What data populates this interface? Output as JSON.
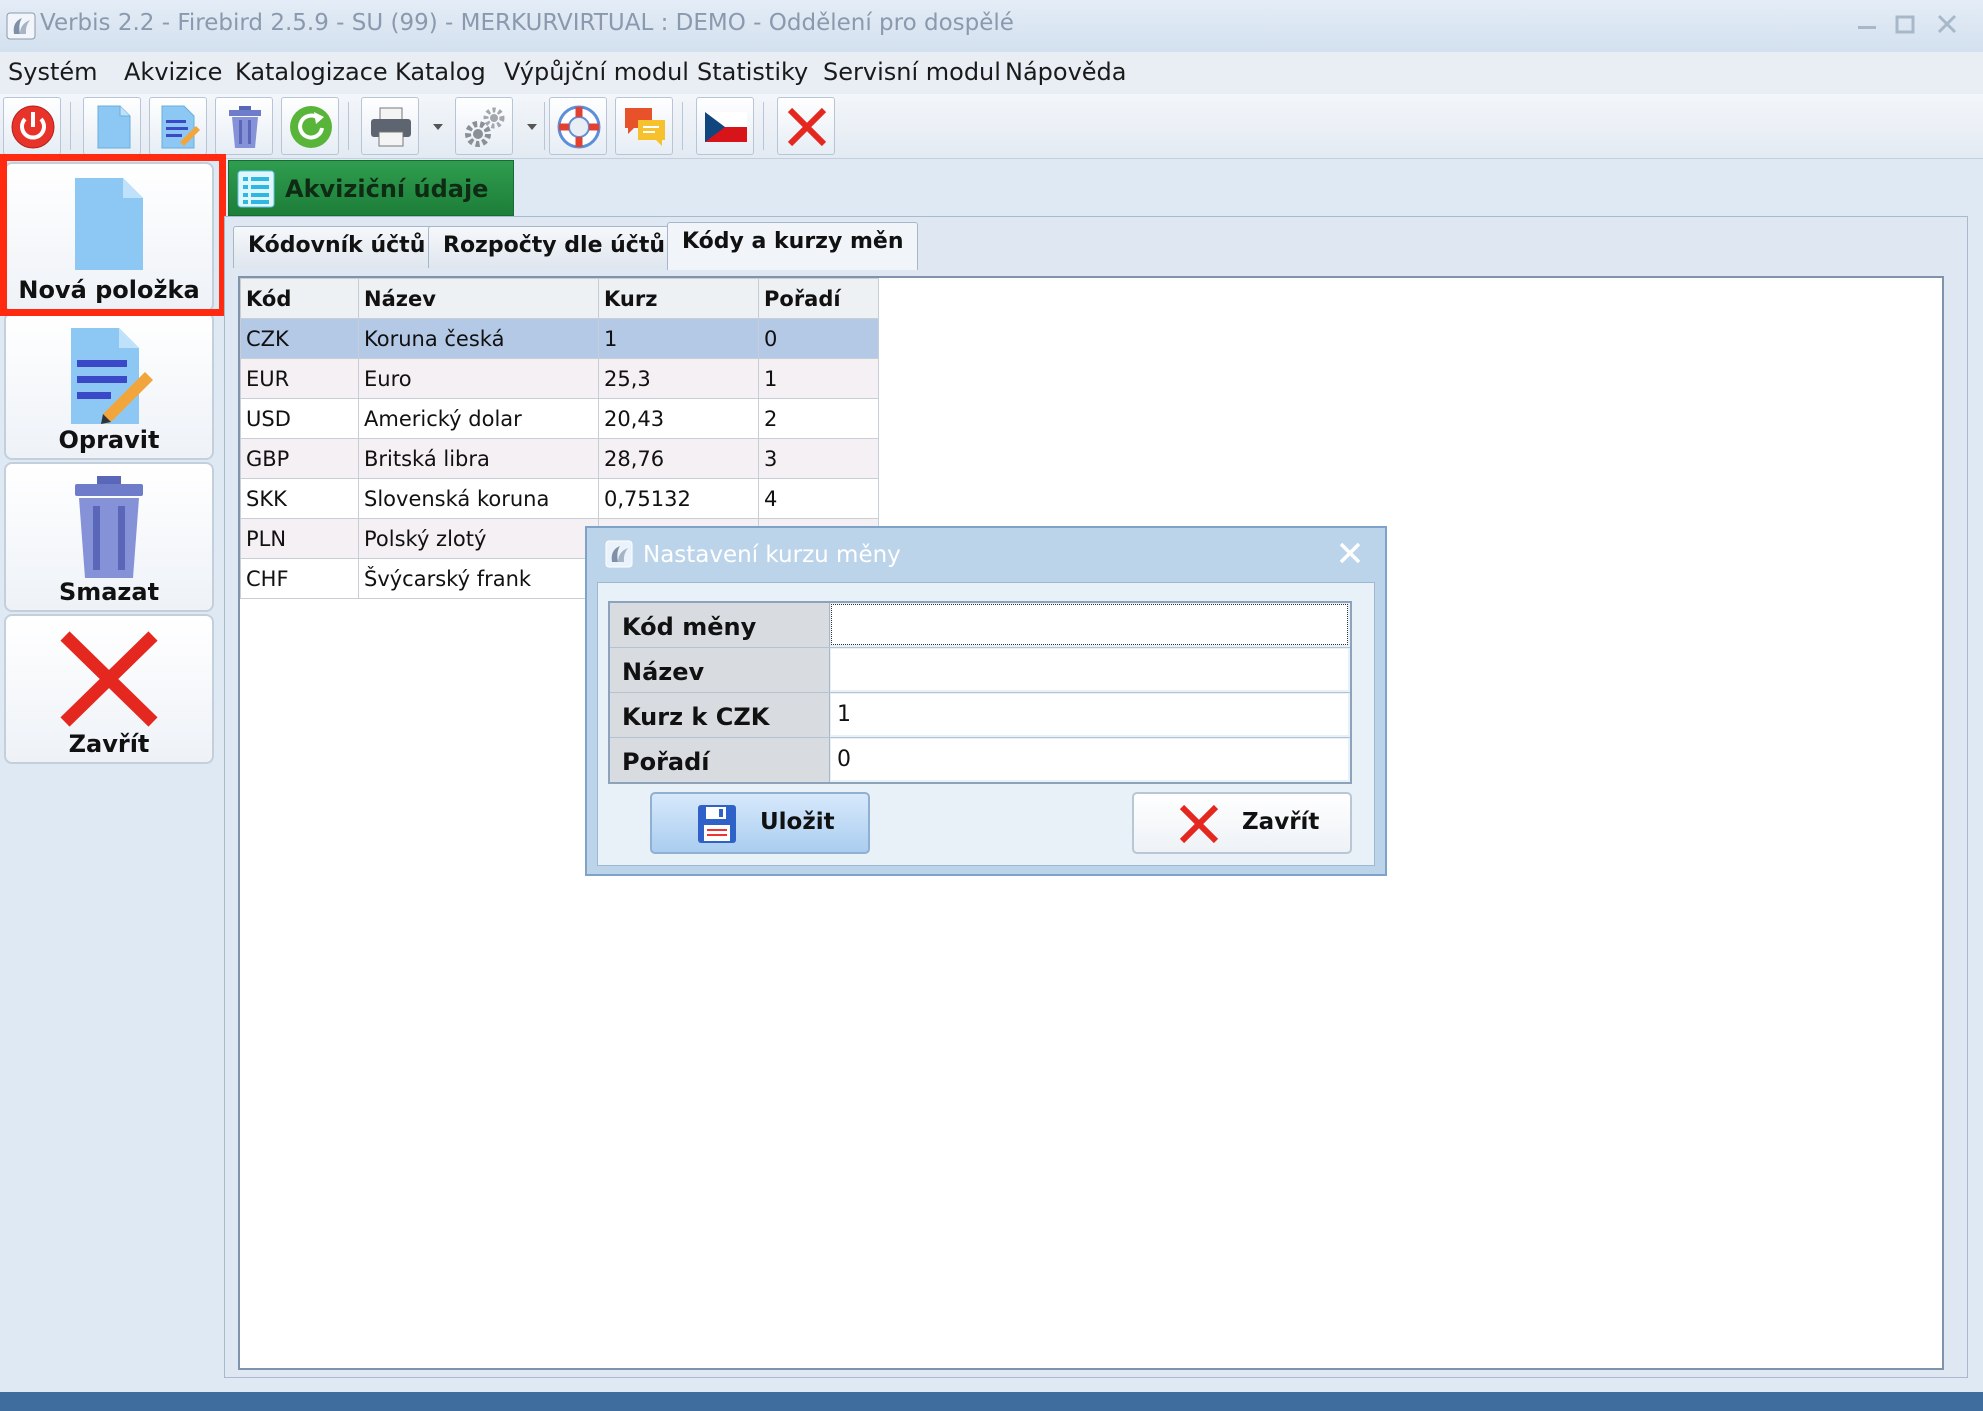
{
  "window": {
    "title": "Verbis 2.2 - Firebird 2.5.9 - SU (99) - MERKURVIRTUAL : DEMO - Oddělení pro dospělé"
  },
  "menu": [
    {
      "label": "Systém"
    },
    {
      "label": "Akvizice"
    },
    {
      "label": "Katalogizace"
    },
    {
      "label": "Katalog"
    },
    {
      "label": "Výpůjční modul"
    },
    {
      "label": "Statistiky"
    },
    {
      "label": "Servisní modul"
    },
    {
      "label": "Nápověda"
    }
  ],
  "sidebar": {
    "new_label": "Nová položka",
    "edit_label": "Opravit",
    "delete_label": "Smazat",
    "close_label": "Zavřít"
  },
  "panel": {
    "title": "Akviziční údaje"
  },
  "subtabs": [
    {
      "label": "Kódovník účtů"
    },
    {
      "label": "Rozpočty dle účtů"
    },
    {
      "label": "Kódy a kurzy měn"
    }
  ],
  "grid": {
    "headers": [
      "Kód",
      "Název",
      "Kurz",
      "Pořadí"
    ],
    "rows": [
      [
        "CZK",
        "Koruna česká",
        "1",
        "0"
      ],
      [
        "EUR",
        "Euro",
        "25,3",
        "1"
      ],
      [
        "USD",
        "Americký dolar",
        "20,43",
        "2"
      ],
      [
        "GBP",
        "Britská libra",
        "28,76",
        "3"
      ],
      [
        "SKK",
        "Slovenská koruna",
        "0,75132",
        "4"
      ],
      [
        "PLN",
        "Polský zlotý",
        "",
        ""
      ],
      [
        "CHF",
        "Švýcarský frank",
        "",
        ""
      ]
    ]
  },
  "dialog": {
    "title": "Nastavení kurzu měny",
    "fields": {
      "code_label": "Kód měny",
      "code_value": "",
      "name_label": "Název",
      "name_value": "",
      "rate_label": "Kurz k CZK",
      "rate_value": "1",
      "order_label": "Pořadí",
      "order_value": "0"
    },
    "save_label": "Uložit",
    "close_label": "Zavřít"
  },
  "colors": {
    "accent_green": "#2f9d4f",
    "highlight_red": "#ff2a10",
    "selection_blue": "#b4c9e6"
  }
}
